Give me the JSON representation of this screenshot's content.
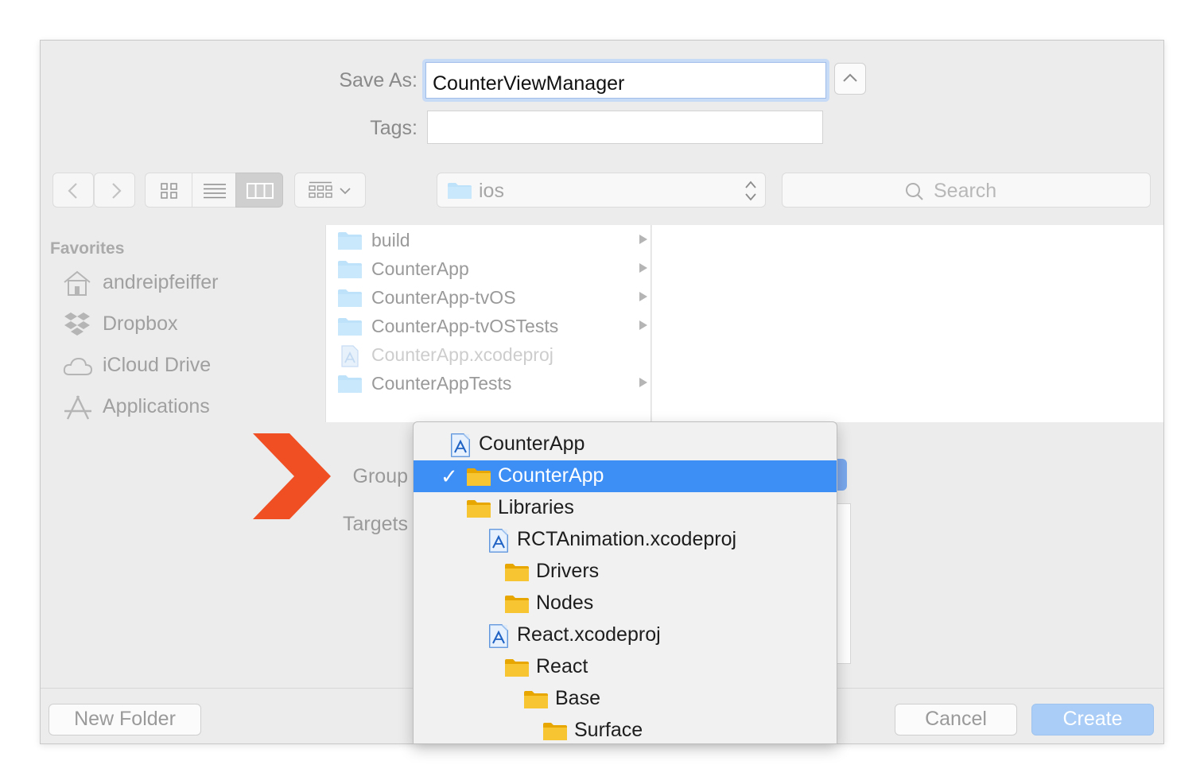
{
  "save": {
    "label": "Save As:",
    "value": "CounterViewManager",
    "tags_label": "Tags:"
  },
  "toolbar": {
    "path_folder": "ios",
    "search_placeholder": "Search"
  },
  "sidebar": {
    "heading": "Favorites",
    "items": [
      {
        "label": "andreipfeiffer",
        "icon": "home-icon"
      },
      {
        "label": "Dropbox",
        "icon": "dropbox-icon"
      },
      {
        "label": "iCloud Drive",
        "icon": "cloud-icon"
      },
      {
        "label": "Applications",
        "icon": "applications-icon"
      }
    ]
  },
  "files": [
    {
      "name": "build",
      "type": "folder",
      "enabled": true
    },
    {
      "name": "CounterApp",
      "type": "folder",
      "enabled": true
    },
    {
      "name": "CounterApp-tvOS",
      "type": "folder",
      "enabled": true
    },
    {
      "name": "CounterApp-tvOSTests",
      "type": "folder",
      "enabled": true
    },
    {
      "name": "CounterApp.xcodeproj",
      "type": "xcodeproj",
      "enabled": false
    },
    {
      "name": "CounterAppTests",
      "type": "folder",
      "enabled": true
    }
  ],
  "options": {
    "group_label": "Group",
    "targets_label": "Targets"
  },
  "group_menu": {
    "items": [
      {
        "label": "CounterApp",
        "type": "xcodeproj",
        "level": 0,
        "selected": false
      },
      {
        "label": "CounterApp",
        "type": "group",
        "level": 1,
        "selected": true
      },
      {
        "label": "Libraries",
        "type": "group",
        "level": 1,
        "selected": false
      },
      {
        "label": "RCTAnimation.xcodeproj",
        "type": "xcodeproj",
        "level": 2,
        "selected": false
      },
      {
        "label": "Drivers",
        "type": "group",
        "level": 3,
        "selected": false
      },
      {
        "label": "Nodes",
        "type": "group",
        "level": 3,
        "selected": false
      },
      {
        "label": "React.xcodeproj",
        "type": "xcodeproj",
        "level": 2,
        "selected": false
      },
      {
        "label": "React",
        "type": "group",
        "level": 3,
        "selected": false
      },
      {
        "label": "Base",
        "type": "group",
        "level": 4,
        "selected": false
      },
      {
        "label": "Surface",
        "type": "group",
        "level": 5,
        "selected": false
      }
    ]
  },
  "buttons": {
    "new_folder": "New Folder",
    "cancel": "Cancel",
    "create": "Create"
  },
  "colors": {
    "accent": "#3d8ff5",
    "annotation_arrow": "#f04e23",
    "folder_blue": "#bfe2fb",
    "folder_yellow": "#f7c531"
  }
}
